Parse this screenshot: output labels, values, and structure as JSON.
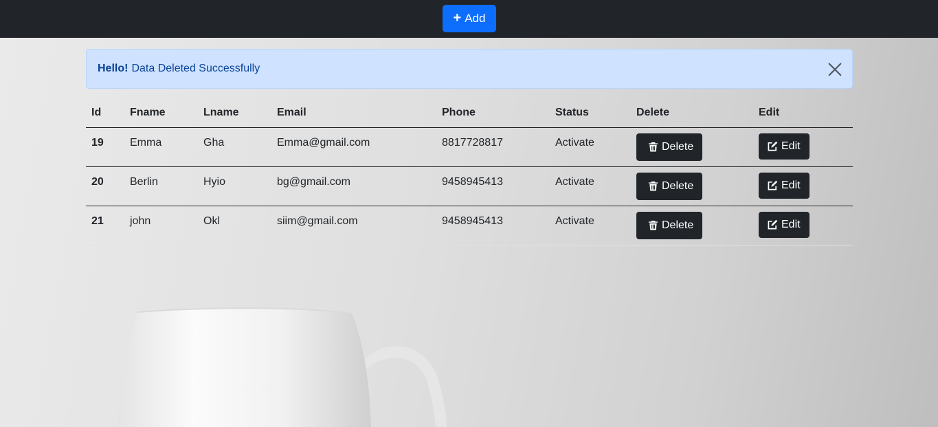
{
  "navbar": {
    "add_label": "Add"
  },
  "alert": {
    "strong": "Hello!",
    "message": "Data Deleted Successfully"
  },
  "table": {
    "headers": [
      "Id",
      "Fname",
      "Lname",
      "Email",
      "Phone",
      "Status",
      "Delete",
      "Edit"
    ],
    "rows": [
      {
        "id": "19",
        "fname": "Emma",
        "lname": "Gha",
        "email": "Emma@gmail.com",
        "phone": "8817728817",
        "status": "Activate",
        "delete_label": "Delete",
        "edit_label": "Edit"
      },
      {
        "id": "20",
        "fname": "Berlin",
        "lname": "Hyio",
        "email": "bg@gmail.com",
        "phone": "9458945413",
        "status": "Activate",
        "delete_label": "Delete",
        "edit_label": "Edit"
      },
      {
        "id": "21",
        "fname": "john",
        "lname": "Okl",
        "email": "siim@gmail.com",
        "phone": "9458945413",
        "status": "Activate",
        "delete_label": "Delete",
        "edit_label": "Edit"
      }
    ]
  },
  "icons": {
    "add": "plus-icon",
    "close": "close-icon",
    "delete": "trash-icon",
    "edit": "edit-icon"
  },
  "colors": {
    "navbar": "#212529",
    "primary": "#0d6efd",
    "alert_bg": "#cfe2ff",
    "alert_text": "#084298",
    "dark_button": "#212529"
  }
}
